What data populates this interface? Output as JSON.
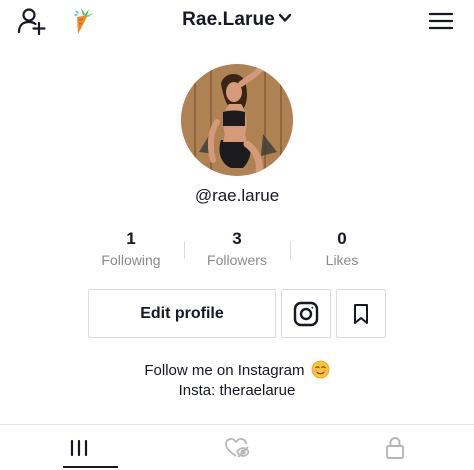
{
  "header": {
    "username_title": "Rae.Larue",
    "icons": [
      "add-user-icon",
      "carrot-icon",
      "chevron-down-icon",
      "menu-icon"
    ]
  },
  "profile": {
    "handle": "@rae.larue"
  },
  "stats": [
    {
      "value": "1",
      "label": "Following"
    },
    {
      "value": "3",
      "label": "Followers"
    },
    {
      "value": "0",
      "label": "Likes"
    }
  ],
  "actions": {
    "edit_profile_label": "Edit profile",
    "icons": [
      "instagram-icon",
      "bookmark-icon"
    ]
  },
  "bio": {
    "line1": "Follow me on Instagram",
    "line1_emoji": "☺",
    "line2": "Insta: theraelarue"
  },
  "tabs": {
    "icons": [
      "videos-grid-icon",
      "liked-hidden-icon",
      "private-lock-icon"
    ],
    "active_index": 0
  },
  "colors": {
    "text": "#161823",
    "secondary_text": "#8a8b91",
    "border": "#dcdcde"
  }
}
